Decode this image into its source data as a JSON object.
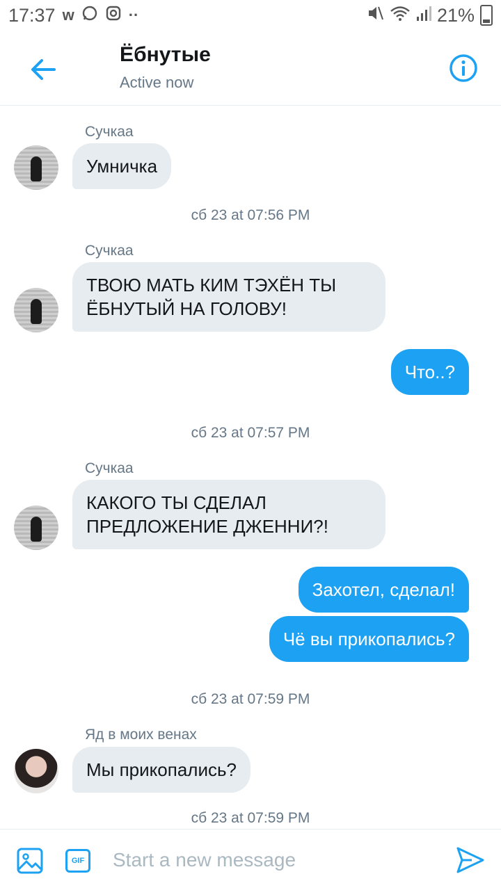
{
  "status_bar": {
    "time": "17:37",
    "left_icons": [
      "w-logo-icon",
      "whatsapp-icon",
      "instagram-icon",
      "more-dots-icon"
    ],
    "battery": "21%"
  },
  "header": {
    "title": "Ёбнутые",
    "subtitle": "Active now"
  },
  "messages": [
    {
      "type": "in",
      "sender": "Сучкаа",
      "text": "Умничка"
    },
    {
      "type": "stamp",
      "text": "сб 23 at 07:56 PM"
    },
    {
      "type": "in",
      "sender": "Сучкаа",
      "text": "ТВОЮ МАТЬ КИМ ТЭХЁН ТЫ ЁБНУТЫЙ НА ГОЛОВУ!"
    },
    {
      "type": "out",
      "text": "Что..?"
    },
    {
      "type": "stamp",
      "text": "сб 23 at 07:57 PM"
    },
    {
      "type": "in",
      "sender": "Сучкаа",
      "text": "КАКОГО ТЫ СДЕЛАЛ ПРЕДЛОЖЕНИЕ ДЖЕННИ?!"
    },
    {
      "type": "out",
      "text": "Захотел, сделал!"
    },
    {
      "type": "out",
      "text": "Чё вы прикопались?"
    },
    {
      "type": "stamp",
      "text": "сб 23 at 07:59 PM"
    },
    {
      "type": "in",
      "sender": "Яд в моих венах",
      "text": "Мы прикопались?"
    },
    {
      "type": "stamp",
      "text": "сб 23 at 07:59 PM"
    }
  ],
  "composer": {
    "placeholder": "Start a new message",
    "gif_label": "GIF"
  },
  "colors": {
    "accent": "#1da1f2",
    "incoming_bubble": "#e6ecf0",
    "muted_text": "#657786"
  }
}
